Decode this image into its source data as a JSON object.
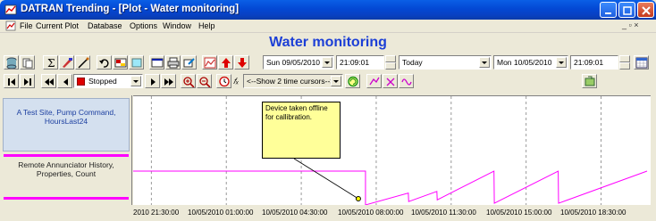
{
  "window": {
    "title": "DATRAN Trending - [Plot - Water monitoring]"
  },
  "menu": {
    "items": [
      "File",
      "Current Plot",
      "Database",
      "Options",
      "Window",
      "Help"
    ],
    "mdi_controls": "_ ▫ ×"
  },
  "plot": {
    "heading": "Water monitoring"
  },
  "toolbar": {
    "start_date": "Sun 09/05/2010",
    "start_time": "21:09:01",
    "range_mode": "Today",
    "end_date": "Mon 10/05/2010",
    "end_time": "21:09:01",
    "play_state": "Stopped",
    "cursor_mode": "<--Show 2 time cursors-->"
  },
  "legend": {
    "trace1": "A Test Site, Pump Command, HoursLast24",
    "trace2": "Remote Annunciator History, Properties, Count"
  },
  "annotation": {
    "text": "Device taken offline for callibration."
  },
  "colors": {
    "trace": "#ff00ff",
    "title_blue": "#1c3fd6",
    "note_bg": "#ffff99"
  },
  "chart_data": {
    "type": "line",
    "x_tick_labels": [
      "2010 21:30:00",
      "10/05/2010 01:00:00",
      "10/05/2010 04:30:00",
      "10/05/2010 08:00:00",
      "10/05/2010 11:30:00",
      "10/05/2010 15:00:00",
      "10/05/2010 18:30:00"
    ],
    "series": [
      {
        "points": [
          [
            "09/05/2010 21:09",
            1.0
          ],
          [
            "10/05/2010 08:00",
            1.0
          ],
          [
            "10/05/2010 08:00",
            0.0
          ],
          [
            "10/05/2010 10:00",
            0.35
          ],
          [
            "10/05/2010 10:01",
            0.1
          ],
          [
            "10/05/2010 11:20",
            0.4
          ],
          [
            "10/05/2010 11:21",
            0.15
          ],
          [
            "10/05/2010 14:00",
            1.0
          ],
          [
            "10/05/2010 14:01",
            0.05
          ],
          [
            "10/05/2010 17:00",
            1.0
          ],
          [
            "10/05/2010 17:01",
            0.05
          ],
          [
            "10/05/2010 21:09",
            1.0
          ]
        ]
      }
    ],
    "grid": true
  }
}
